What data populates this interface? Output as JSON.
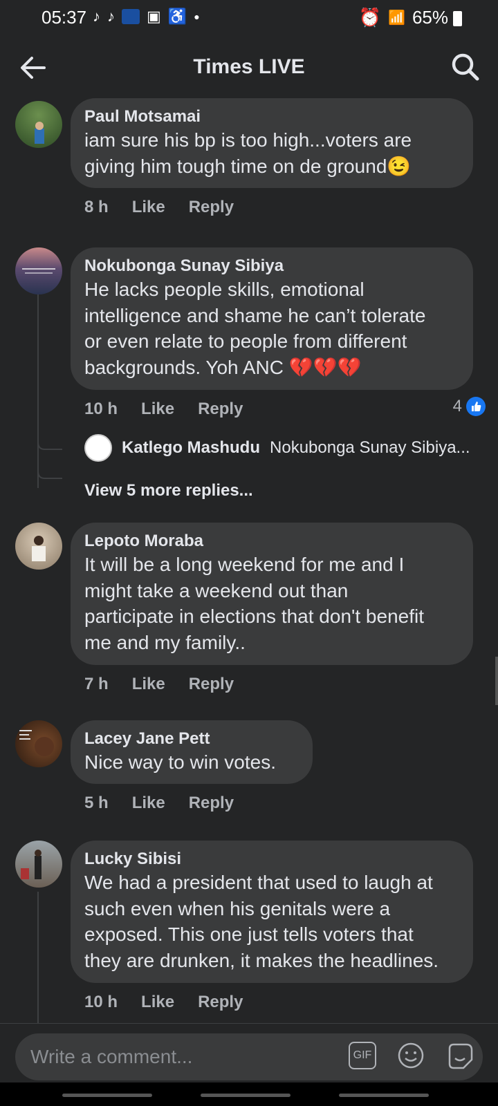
{
  "status": {
    "time": "05:37",
    "battery": "65%"
  },
  "header": {
    "title": "Times LIVE"
  },
  "comments": [
    {
      "author": "Paul Motsamai",
      "lines": [
        "iam sure his bp is too high...voters are",
        "giving him tough time on de ground😉"
      ],
      "time": "8 h",
      "like": "Like",
      "reply": "Reply"
    },
    {
      "author": "Nokubonga Sunay Sibiya",
      "lines": [
        "He lacks people skills, emotional",
        "intelligence and shame he can’t tolerate",
        "or even relate to people from different",
        "backgrounds. Yoh ANC 💔💔💔"
      ],
      "time": "10 h",
      "like": "Like",
      "reply": "Reply",
      "reactions": "4"
    },
    {
      "author": "Lepoto Moraba",
      "lines": [
        "It will be a long weekend for me and I",
        "might take a weekend out than",
        "participate in elections that don't benefit",
        "me and my family.."
      ],
      "time": "7 h",
      "like": "Like",
      "reply": "Reply"
    },
    {
      "author": "Lacey Jane Pett",
      "lines": [
        "Nice way to win votes."
      ],
      "time": "5 h",
      "like": "Like",
      "reply": "Reply"
    },
    {
      "author": "Lucky Sibisi",
      "lines": [
        "We had a president that used to laugh at",
        "such even when his genitals were a",
        "exposed. This one just tells voters that",
        "they are drunken, it makes the headlines."
      ],
      "time": "10 h",
      "like": "Like",
      "reply": "Reply"
    }
  ],
  "reply_preview": {
    "author": "Katlego Mashudu",
    "snippet": "Nokubonga Sunay Sibiya...",
    "view_more": "View 5 more replies..."
  },
  "composer": {
    "placeholder": "Write a comment...",
    "gif": "GIF"
  },
  "colors": {
    "background": "#242526",
    "bubble": "#3a3b3c",
    "accent": "#1877f2",
    "meta": "#b0b3b8"
  }
}
